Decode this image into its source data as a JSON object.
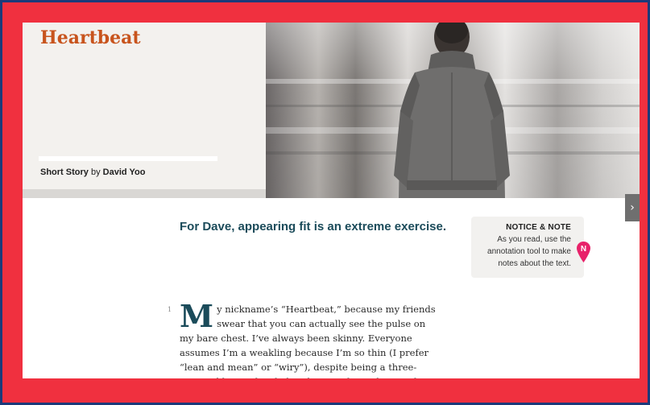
{
  "story": {
    "title": "Heartbeat",
    "genre": "Short Story",
    "by": "by",
    "author": "David Yoo",
    "subtitle": "For Dave, appearing fit is an extreme exercise."
  },
  "notice_note": {
    "title": "NOTICE & NOTE",
    "body": "As you read, use the annotation tool to make notes about the text.",
    "pin_letter": "N",
    "pin_color": "#e8226a"
  },
  "navigation": {
    "next_icon": "chevron-right-icon",
    "next_symbol": "›"
  },
  "passage": {
    "paragraph_number": "1",
    "drop_cap": "M",
    "text": "y nickname’s “Heartbeat,” because my friends swear that you can actually see the pulse on my bare chest. I’ve always been skinny. Everyone assumes I’m a weakling because I’m so thin (I prefer “lean and mean” or “wiry”), despite being a three-sport athlete. I decided to do something about it this fall when Sarah, the girl I have a crush on, said"
  },
  "colors": {
    "outer_border": "#1c3a7a",
    "frame": "#f0303f",
    "title_accent": "#c8541d",
    "heading_teal": "#1b4b5a"
  }
}
